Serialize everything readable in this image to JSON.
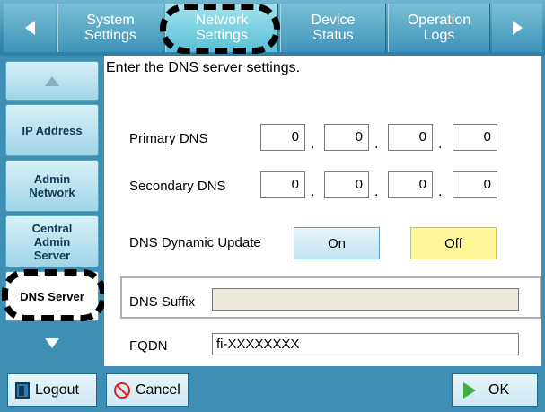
{
  "header": {
    "tabs": [
      {
        "label": "System\nSettings",
        "active": false
      },
      {
        "label": "Network\nSettings",
        "active": true
      },
      {
        "label": "Device\nStatus",
        "active": false
      },
      {
        "label": "Operation\nLogs",
        "active": false
      }
    ]
  },
  "sidebar": {
    "items": [
      {
        "label": "IP Address"
      },
      {
        "label": "Admin\nNetwork"
      },
      {
        "label": "Central\nAdmin\nServer"
      },
      {
        "label": "DNS Server",
        "active": true
      }
    ]
  },
  "main": {
    "instruction": "Enter the DNS server settings.",
    "primary_dns": {
      "label": "Primary DNS",
      "octets": [
        "0",
        "0",
        "0",
        "0"
      ]
    },
    "secondary_dns": {
      "label": "Secondary DNS",
      "octets": [
        "0",
        "0",
        "0",
        "0"
      ]
    },
    "dynamic_update": {
      "label": "DNS Dynamic Update",
      "on_label": "On",
      "off_label": "Off",
      "selected": "Off"
    },
    "dns_suffix": {
      "label": "DNS Suffix",
      "value": ""
    },
    "fqdn": {
      "label": "FQDN",
      "value": "fi-XXXXXXXX"
    }
  },
  "footer": {
    "logout_label": "Logout",
    "cancel_label": "Cancel",
    "ok_label": "OK"
  },
  "colors": {
    "frame_blue": "#3f8fb5",
    "selected_toggle": "#fdf79a",
    "highlight_ring": "#000000"
  },
  "icons": [
    "nav-left-icon",
    "nav-right-icon",
    "scroll-up-icon",
    "scroll-down-icon",
    "logout-icon",
    "cancel-icon",
    "ok-arrow-icon"
  ]
}
